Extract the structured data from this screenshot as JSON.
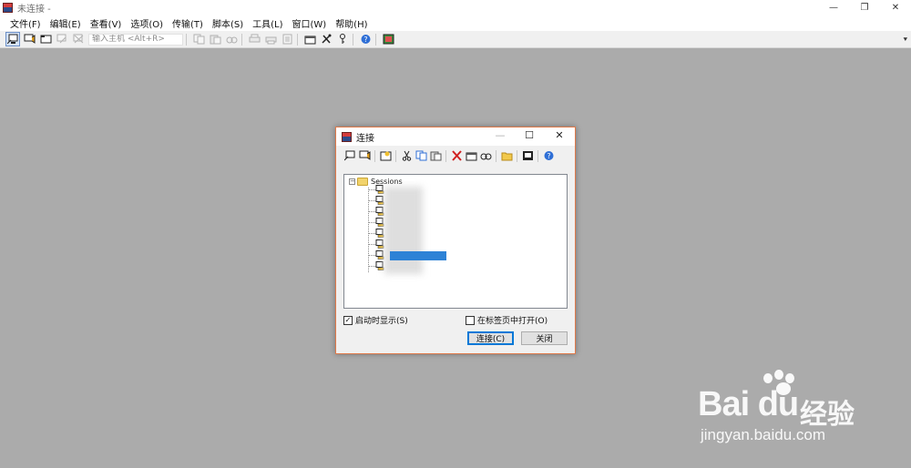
{
  "window": {
    "title": "未连接 -"
  },
  "window_controls": {
    "minimize": "—",
    "restore": "❐",
    "close": "✕"
  },
  "menu": [
    "文件(F)",
    "编辑(E)",
    "查看(V)",
    "选项(O)",
    "传输(T)",
    "脚本(S)",
    "工具(L)",
    "窗口(W)",
    "帮助(H)"
  ],
  "toolbar": {
    "quick_connect_placeholder": "输入主机 <Alt+R>"
  },
  "dialog": {
    "title": "连接",
    "controls": {
      "minimize": "—",
      "maximize": "☐",
      "close": "✕"
    },
    "tree": {
      "root_label": "Sessions",
      "root_expander": "−"
    },
    "show_on_startup": {
      "label": "启动时显示(S)",
      "checked_mark": "✓"
    },
    "open_in_tab": {
      "label": "在标签页中打开(O)"
    },
    "buttons": {
      "connect": "连接(C)",
      "close": "关闭"
    }
  },
  "watermark": {
    "logo": "Bai du",
    "product": "经验",
    "url": "jingyan.baidu.com"
  },
  "colors": {
    "workspace": "#ababab",
    "dialog_border": "#e07a4a",
    "selection": "#2d82d6"
  }
}
